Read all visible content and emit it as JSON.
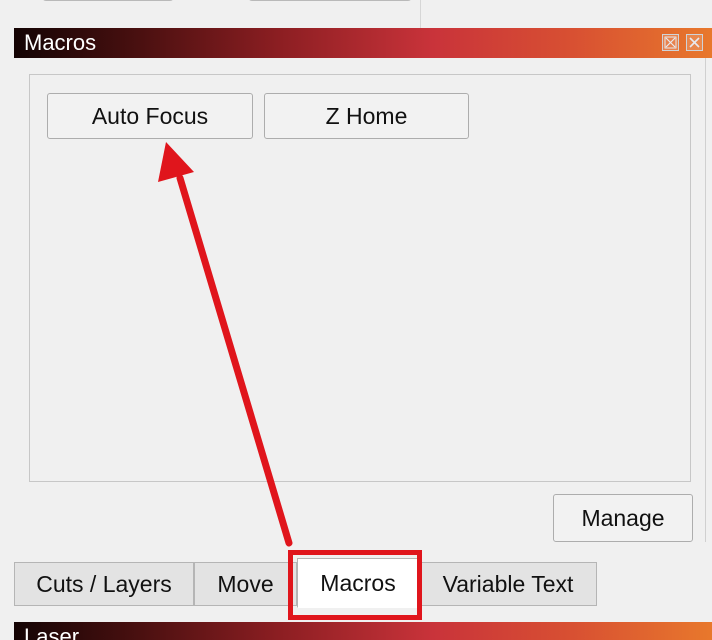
{
  "dock": {
    "title": "Macros",
    "float_icon": "float-icon",
    "close_icon": "close-icon"
  },
  "macros": {
    "buttons": [
      {
        "label": "Auto Focus"
      },
      {
        "label": "Z Home"
      }
    ],
    "manage_label": "Manage"
  },
  "tabs": [
    {
      "label": "Cuts / Layers",
      "active": false
    },
    {
      "label": "Move",
      "active": false
    },
    {
      "label": "Macros",
      "active": true
    },
    {
      "label": "Variable Text",
      "active": false
    }
  ],
  "next_dock": {
    "title": "Laser"
  },
  "annotation": {
    "color": "#e0151c"
  }
}
